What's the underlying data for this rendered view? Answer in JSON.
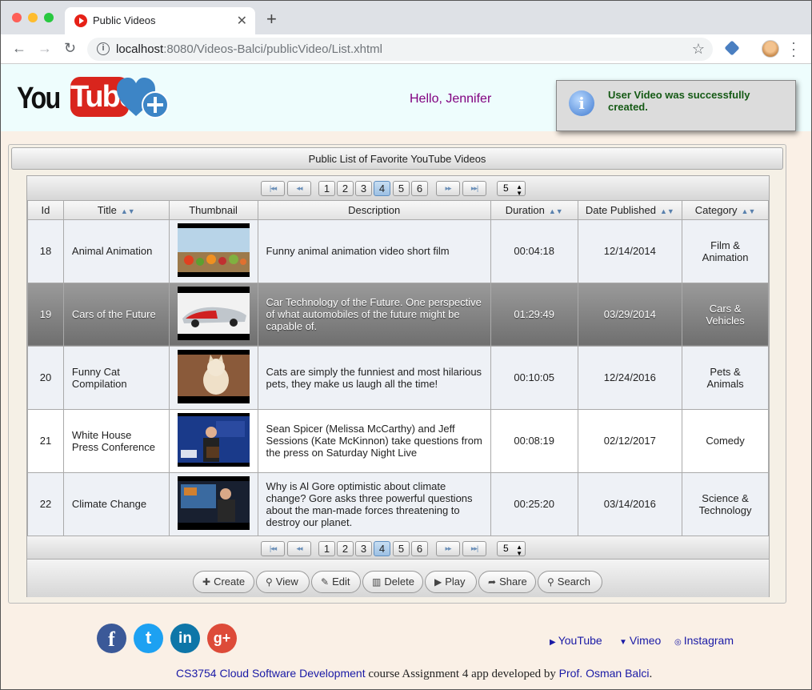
{
  "browser": {
    "tab_title": "Public Videos",
    "close_glyph": "✕",
    "new_tab_glyph": "+",
    "url_host": "localhost",
    "url_rest": ":8080/Videos-Balci/publicVideo/List.xhtml"
  },
  "header": {
    "logo_you": "You",
    "logo_tube": "Tube",
    "greeting": "Hello, Jennifer",
    "growl_icon": "i",
    "growl_message": "User Video was successfully created."
  },
  "panel": {
    "title": "Public List of Favorite YouTube Videos"
  },
  "paginator": {
    "first": "|◂◂",
    "prev": "◂◂",
    "next": "▸▸",
    "last": "▸▸|",
    "pages": [
      "1",
      "2",
      "3",
      "4",
      "5",
      "6"
    ],
    "active_page": "4",
    "rows_per_page": "5"
  },
  "table": {
    "columns": [
      "Id",
      "Title",
      "Thumbnail",
      "Description",
      "Duration",
      "Date Published",
      "Category"
    ],
    "rows": [
      {
        "id": "18",
        "title": "Animal Animation",
        "description": "Funny animal animation video short film",
        "duration": "00:04:18",
        "date": "12/14/2014",
        "category": "Film & Animation"
      },
      {
        "id": "19",
        "title": "Cars of the Future",
        "description": "Car Technology of the Future. One perspective of what automobiles of the future might be capable of.",
        "duration": "01:29:49",
        "date": "03/29/2014",
        "category": "Cars & Vehicles"
      },
      {
        "id": "20",
        "title": "Funny Cat Compilation",
        "description": "Cats are simply the funniest and most hilarious pets, they make us laugh all the time!",
        "duration": "00:10:05",
        "date": "12/24/2016",
        "category": "Pets & Animals"
      },
      {
        "id": "21",
        "title": "White House Press Conference",
        "description": "Sean Spicer (Melissa McCarthy) and Jeff Sessions (Kate McKinnon) take questions from the press on Saturday Night Live",
        "duration": "00:08:19",
        "date": "02/12/2017",
        "category": "Comedy"
      },
      {
        "id": "22",
        "title": "Climate Change",
        "description": "Why is Al Gore optimistic about climate change? Gore asks three powerful questions about the man-made forces threatening to destroy our planet.",
        "duration": "00:25:20",
        "date": "03/14/2016",
        "category": "Science & Technology"
      }
    ],
    "selected_id": "19"
  },
  "actions": {
    "create": "Create",
    "view": "View",
    "edit": "Edit",
    "delete": "Delete",
    "play": "Play",
    "share": "Share",
    "search": "Search"
  },
  "footer": {
    "social": {
      "facebook": "f",
      "twitter": "t",
      "linkedin": "in",
      "googleplus": "g+"
    },
    "links": {
      "youtube": "YouTube",
      "vimeo": "Vimeo",
      "instagram": "Instagram"
    },
    "credit_link1": "CS3754 Cloud Software Development",
    "credit_mid": " course Assignment 4 app developed by ",
    "credit_link2": "Prof. Osman Balci",
    "credit_end": "."
  },
  "colors": {
    "page_bg": "#faf0e6",
    "header_bg": "#eefdfd",
    "greeting": "#800080",
    "growl_text": "#155a15",
    "link": "#1a1aa6",
    "youtube_red": "#d9251d"
  }
}
